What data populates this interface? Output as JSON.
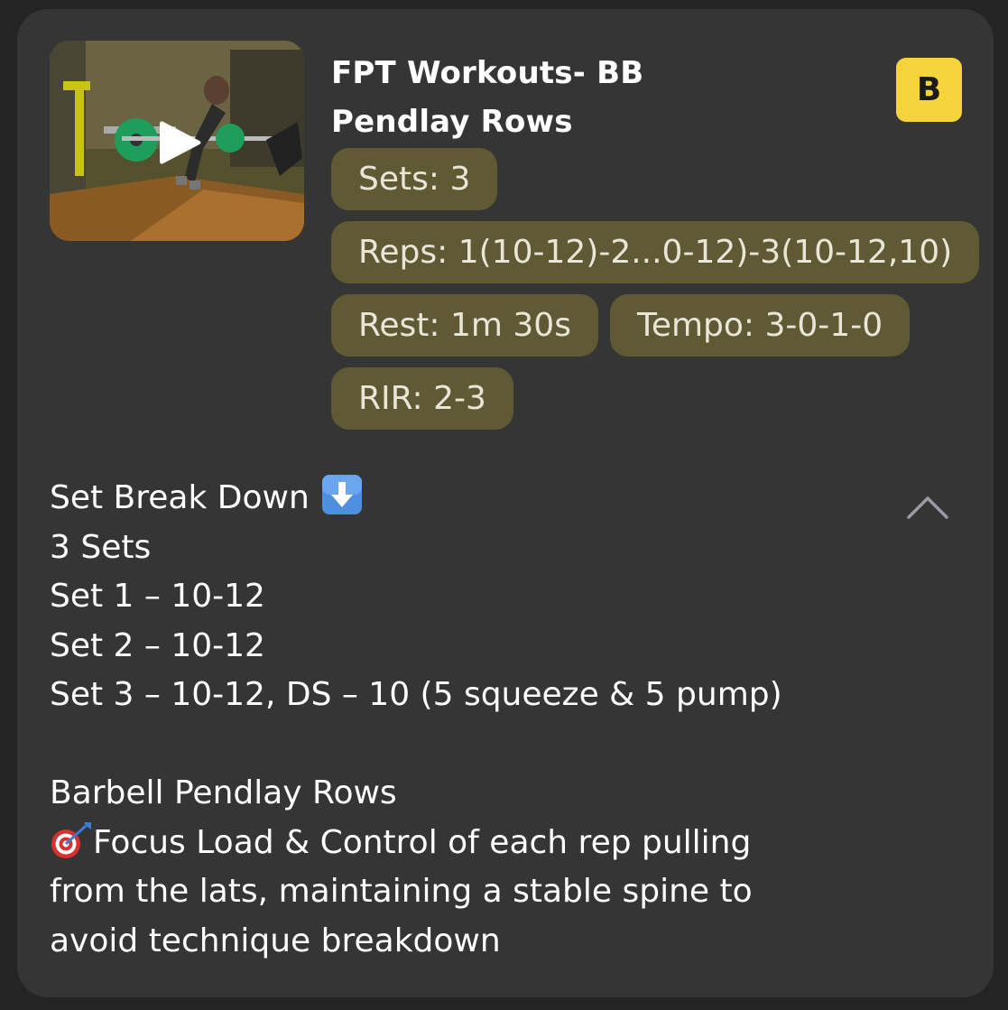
{
  "title_line1": "FPT Workouts- BB",
  "title_line2": "Pendlay Rows",
  "badge": "B",
  "chips": {
    "sets": "Sets: 3",
    "reps": "Reps: 1(10-12)-2...0-12)-3(10-12,10)",
    "rest": "Rest: 1m 30s",
    "tempo": "Tempo: 3-0-1-0",
    "rir": "RIR: 2-3"
  },
  "description": {
    "heading": "Set Break Down",
    "lines": [
      "3 Sets",
      "Set 1 – 10-12",
      "Set 2 – 10-12",
      "Set 3 – 10-12, DS – 10 (5 squeeze & 5 pump)"
    ],
    "exercise": "Barbell Pendlay Rows",
    "focus_line1": "Focus Load & Control of each rep pulling",
    "focus_line2": "from the lats, maintaining a stable spine to",
    "focus_line3": "avoid technique breakdown"
  },
  "icons": {
    "play": "play-icon",
    "collapse": "chevron-up-icon",
    "down_arrow": "down-arrow-emoji-icon",
    "target": "direct-hit-emoji-icon"
  },
  "colors": {
    "card_bg": "#353535",
    "chip_bg": "#605a34",
    "badge_bg": "#f5d33b"
  }
}
